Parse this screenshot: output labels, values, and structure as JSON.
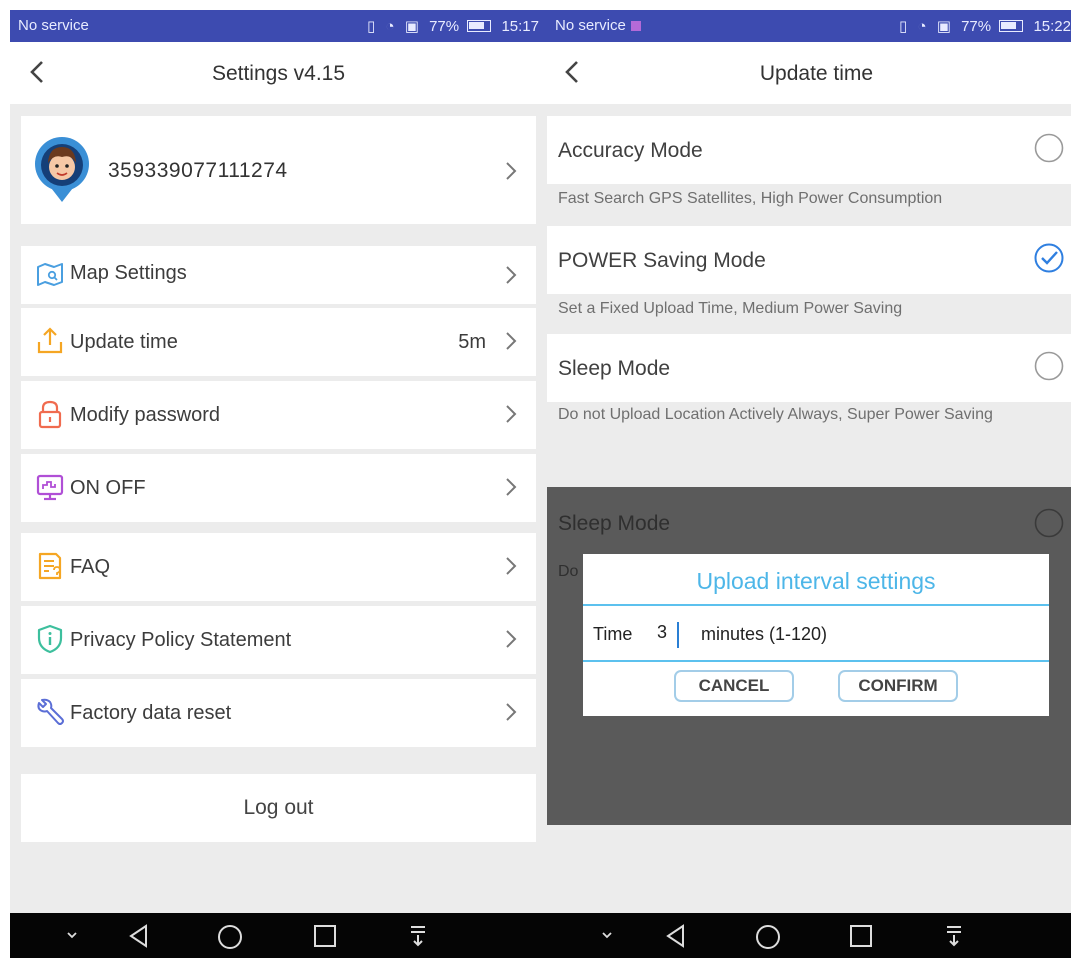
{
  "left_screen": {
    "status_bar": {
      "carrier": "No service",
      "battery_percent": "77%",
      "time": "15:17"
    },
    "header": {
      "title": "Settings v4.15",
      "back_icon": "chevron-left-icon"
    },
    "profile": {
      "device_id": "359339077111274",
      "avatar_icon": "avatar-pin-icon"
    },
    "menu_items": [
      {
        "label": "Map Settings",
        "value": "",
        "icon": "map-icon",
        "color": "#4a9fe0"
      },
      {
        "label": "Update time",
        "value": "5m",
        "icon": "upload-icon",
        "color": "#f5a623"
      },
      {
        "label": "Modify password",
        "value": "",
        "icon": "lock-icon",
        "color": "#f06b4f"
      },
      {
        "label": "ON OFF",
        "value": "",
        "icon": "monitor-icon",
        "color": "#b04fd6"
      },
      {
        "label": "FAQ",
        "value": "",
        "icon": "faq-icon",
        "color": "#f5a623"
      },
      {
        "label": "Privacy Policy Statement",
        "value": "",
        "icon": "shield-icon",
        "color": "#3dbf9d"
      },
      {
        "label": "Factory data reset",
        "value": "",
        "icon": "wrench-icon",
        "color": "#5b6ed6"
      }
    ],
    "logout_label": "Log out"
  },
  "right_screen": {
    "status_bar": {
      "carrier": "No service",
      "battery_percent": "77%",
      "time": "15:22"
    },
    "header": {
      "title": "Update time",
      "back_icon": "chevron-left-icon"
    },
    "modes": [
      {
        "label": "Accuracy Mode",
        "description": "Fast Search GPS Satellites, High Power Consumption",
        "selected": false
      },
      {
        "label": "POWER Saving Mode",
        "description": "Set a Fixed Upload Time, Medium Power Saving",
        "selected": true
      },
      {
        "label": "Sleep Mode",
        "description": "Do not Upload Location Actively Always, Super Power Saving",
        "selected": false
      }
    ],
    "overlay": {
      "mode_label": "Sleep Mode",
      "desc_prefix": "Do"
    },
    "dialog": {
      "title": "Upload interval settings",
      "time_label": "Time",
      "time_value": "3",
      "unit_label": "minutes (1-120)",
      "cancel_label": "CANCEL",
      "confirm_label": "CONFIRM"
    }
  },
  "colors": {
    "status_bar": "#3d4bb0",
    "accent": "#4db6e8",
    "check": "#2f7fe0",
    "background": "#ececec"
  }
}
